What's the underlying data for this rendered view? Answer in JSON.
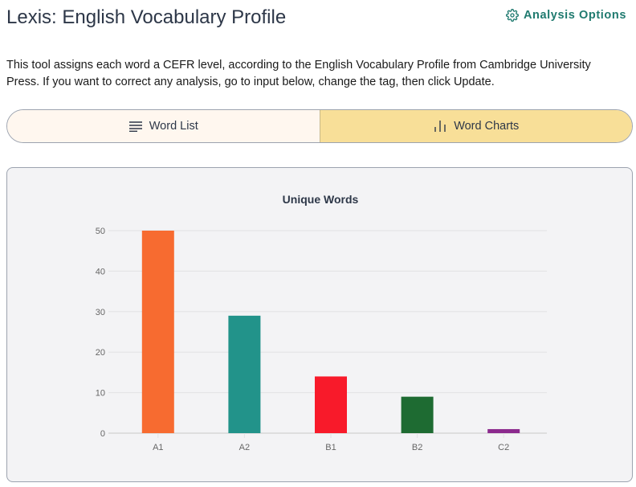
{
  "header": {
    "title": "Lexis: English Vocabulary Profile",
    "analysis_options_label": "Analysis Options",
    "analysis_icon": "gear-icon"
  },
  "description": "This tool assigns each word a CEFR level, according to the English Vocabulary Profile from Cambridge University Press. If you want to correct any analysis, go to input below, change the tag, then click Update.",
  "tabs": [
    {
      "label": "Word List",
      "icon": "list-icon",
      "active": false
    },
    {
      "label": "Word Charts",
      "icon": "bar-chart-icon",
      "active": true
    }
  ],
  "colors": {
    "accent": "#1f7a6f",
    "active_tab": "#f8df98",
    "inactive_tab": "#fff7ef"
  },
  "chart_data": {
    "type": "bar",
    "title": "Unique Words",
    "categories": [
      "A1",
      "A2",
      "B1",
      "B2",
      "C2"
    ],
    "values": [
      50,
      29,
      14,
      9,
      1
    ],
    "colors": [
      "#f76b30",
      "#22938a",
      "#f81a2a",
      "#1e6b32",
      "#8c2a8e"
    ],
    "yticks": [
      0,
      10,
      20,
      30,
      40,
      50
    ],
    "ylim": [
      0,
      50
    ],
    "grid": true,
    "legend": "none"
  }
}
